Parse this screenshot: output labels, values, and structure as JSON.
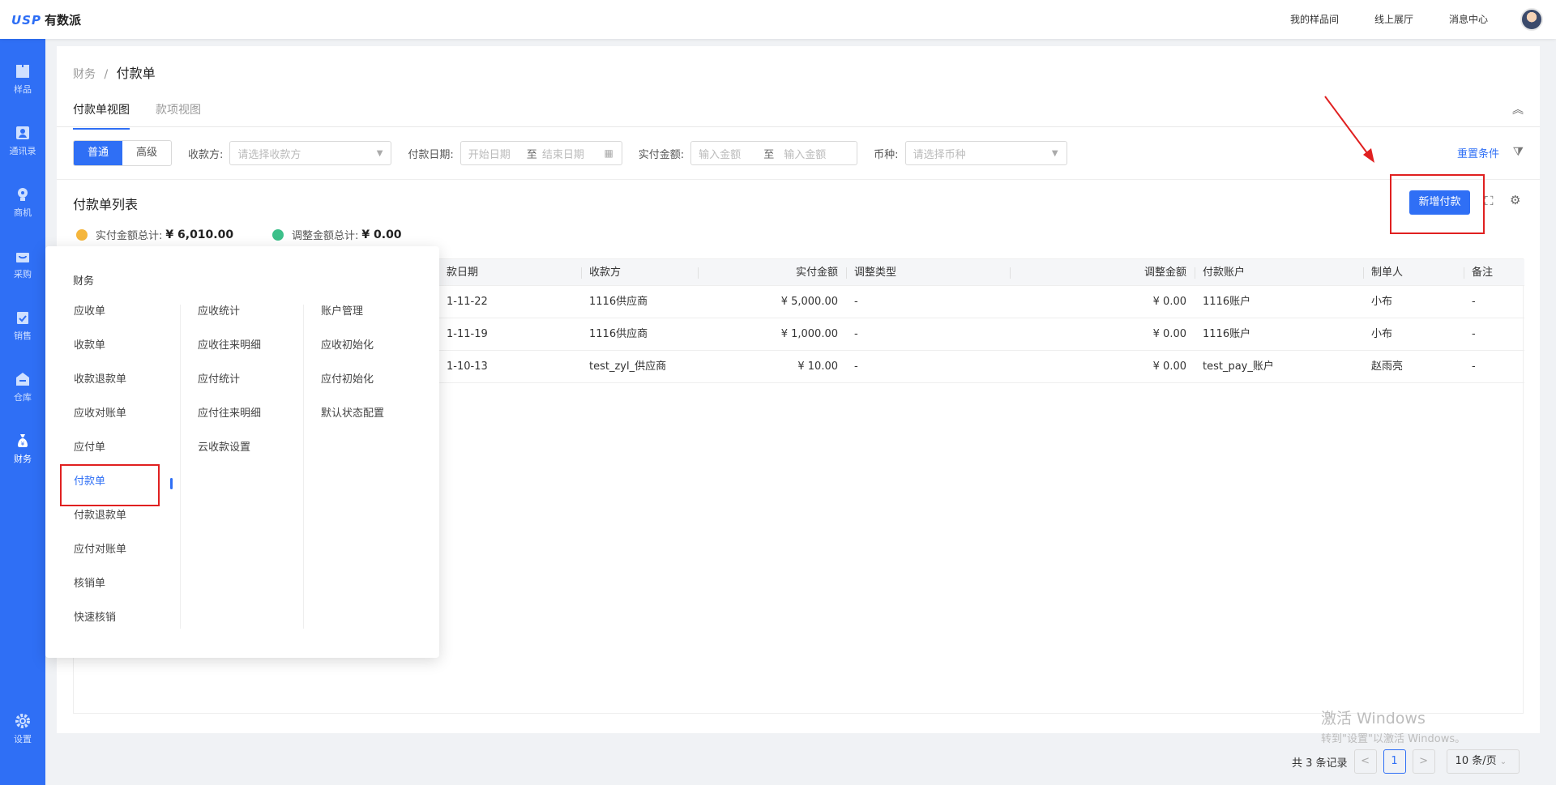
{
  "topbar": {
    "logo_mark": "USP",
    "logo_text": "有数派",
    "links": [
      "我的样品间",
      "线上展厅",
      "消息中心"
    ]
  },
  "sidebar": {
    "items": [
      {
        "label": "样品",
        "icon": "box-icon"
      },
      {
        "label": "通讯录",
        "icon": "contacts-icon"
      },
      {
        "label": "商机",
        "icon": "lightbulb-icon"
      },
      {
        "label": "采购",
        "icon": "basket-icon"
      },
      {
        "label": "销售",
        "icon": "clipboard-check-icon"
      },
      {
        "label": "仓库",
        "icon": "warehouse-icon"
      },
      {
        "label": "财务",
        "icon": "money-bag-icon",
        "active": true
      },
      {
        "label": "设置",
        "icon": "gear-icon"
      }
    ]
  },
  "breadcrumb": {
    "parent": "财务",
    "separator": "/",
    "current": "付款单"
  },
  "tabs": [
    "付款单视图",
    "款项视图"
  ],
  "filters": {
    "mode_normal": "普通",
    "mode_advanced": "高级",
    "payee_label": "收款方:",
    "payee_placeholder": "请选择收款方",
    "date_label": "付款日期:",
    "date_start": "开始日期",
    "date_to": "至",
    "date_end": "结束日期",
    "amount_label": "实付金额:",
    "amount_min": "输入金额",
    "amount_to": "至",
    "amount_max": "输入金额",
    "currency_label": "币种:",
    "currency_placeholder": "请选择币种",
    "reset": "重置条件"
  },
  "list": {
    "title": "付款单列表",
    "add_button": "新增付款",
    "paid_total_label": "实付金额总计:",
    "paid_total_value": "¥ 6,010.00",
    "adjust_total_label": "调整金额总计:",
    "adjust_total_value": "¥ 0.00"
  },
  "table": {
    "columns": [
      "款日期",
      "收款方",
      "实付金额",
      "调整类型",
      "调整金额",
      "付款账户",
      "制单人",
      "备注"
    ],
    "rows": [
      [
        "1-11-22",
        "1116供应商",
        "¥ 5,000.00",
        "-",
        "¥ 0.00",
        "1116账户",
        "小布",
        "-"
      ],
      [
        "1-11-19",
        "1116供应商",
        "¥ 1,000.00",
        "-",
        "¥ 0.00",
        "1116账户",
        "小布",
        "-"
      ],
      [
        "1-10-13",
        "test_zyl_供应商",
        "¥ 10.00",
        "-",
        "¥ 0.00",
        "test_pay_账户",
        "赵雨亮",
        "-"
      ]
    ]
  },
  "pagination": {
    "total": "共 3 条记录",
    "prev": "<",
    "page": "1",
    "next": ">",
    "page_size": "10 条/页"
  },
  "watermark": {
    "line1": "激活 Windows",
    "line2": "转到\"设置\"以激活 Windows。"
  },
  "menu": {
    "title": "财务",
    "col1": [
      "应收单",
      "收款单",
      "收款退款单",
      "应收对账单",
      "应付单",
      "付款单",
      "付款退款单",
      "应付对账单",
      "核销单",
      "快速核销"
    ],
    "col2": [
      "应收统计",
      "应收往来明细",
      "应付统计",
      "应付往来明细",
      "云收款设置"
    ],
    "col3": [
      "账户管理",
      "应收初始化",
      "应付初始化",
      "默认状态配置"
    ]
  },
  "colors": {
    "primary": "#2f6ff5",
    "highlight": "#e02020",
    "sidebar": "#2f6ff5"
  }
}
